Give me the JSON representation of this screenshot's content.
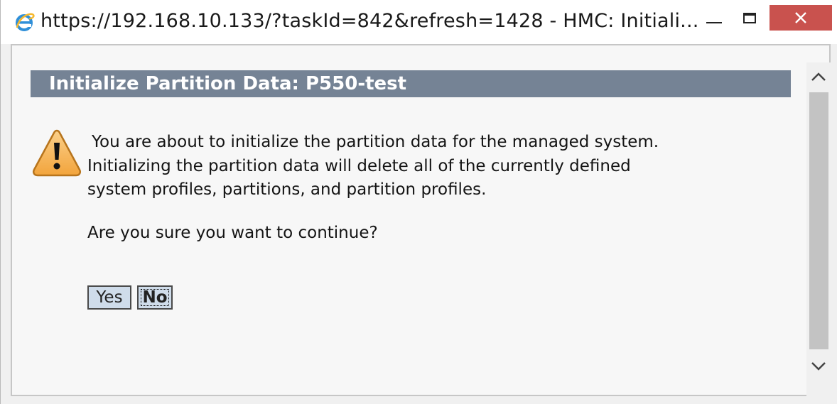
{
  "window": {
    "title": "https://192.168.10.133/?taskId=842&refresh=1428 - HMC: Initiali...",
    "close_color": "#c9524e"
  },
  "icons": {
    "browser": "internet-explorer-icon",
    "warning": "warning-triangle-icon",
    "minimize": "minimize-icon",
    "maximize": "maximize-icon",
    "close": "close-icon",
    "scroll_up": "chevron-up-icon",
    "scroll_down": "chevron-down-icon"
  },
  "dialog": {
    "header": "Initialize Partition Data: P550-test",
    "header_color": "#758395",
    "message_lines": [
      "You are about to initialize the partition data for the managed system.",
      "Initializing the partition data will delete all of the currently defined",
      "system profiles, partitions, and partition profiles."
    ],
    "question": "Are you sure you want to continue?",
    "yes_label": "Yes",
    "no_label": "No"
  }
}
